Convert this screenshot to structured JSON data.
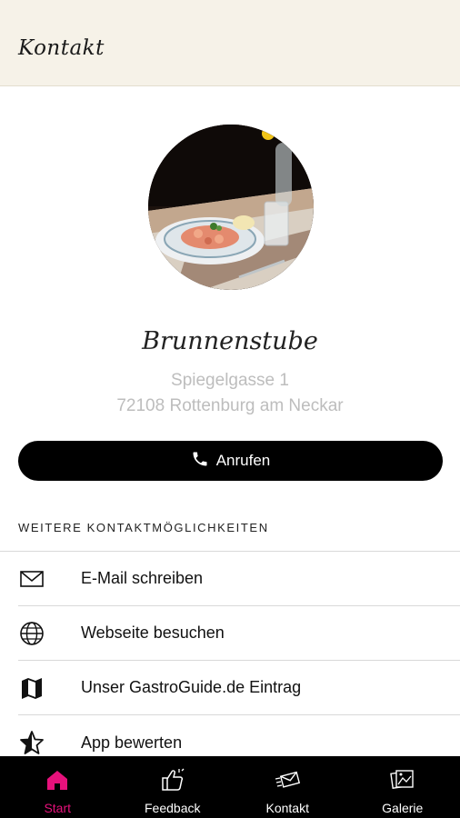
{
  "header": {
    "title": "Kontakt"
  },
  "restaurant": {
    "name": "Brunnenstube",
    "address_line1": "Spiegelgasse 1",
    "address_line2": "72108 Rottenburg am Neckar"
  },
  "call_button": {
    "label": "Anrufen",
    "icon": "phone-icon"
  },
  "section": {
    "label": "WEITERE KONTAKTMÖGLICHKEITEN"
  },
  "contact_items": [
    {
      "label": "E-Mail schreiben",
      "icon": "envelope-icon"
    },
    {
      "label": "Webseite besuchen",
      "icon": "globe-icon"
    },
    {
      "label": "Unser GastroGuide.de Eintrag",
      "icon": "map-icon"
    },
    {
      "label": "App bewerten",
      "icon": "star-icon"
    }
  ],
  "nav": {
    "items": [
      {
        "label": "Start",
        "icon": "home-icon",
        "active": true
      },
      {
        "label": "Feedback",
        "icon": "thumbs-up-icon",
        "active": false
      },
      {
        "label": "Kontakt",
        "icon": "contact-icon",
        "active": false
      },
      {
        "label": "Galerie",
        "icon": "gallery-icon",
        "active": false
      }
    ]
  },
  "colors": {
    "accent": "#e6117b",
    "header_bg": "#f6f2e8",
    "nav_bg": "#000000",
    "address_text": "#bdbdbd"
  }
}
